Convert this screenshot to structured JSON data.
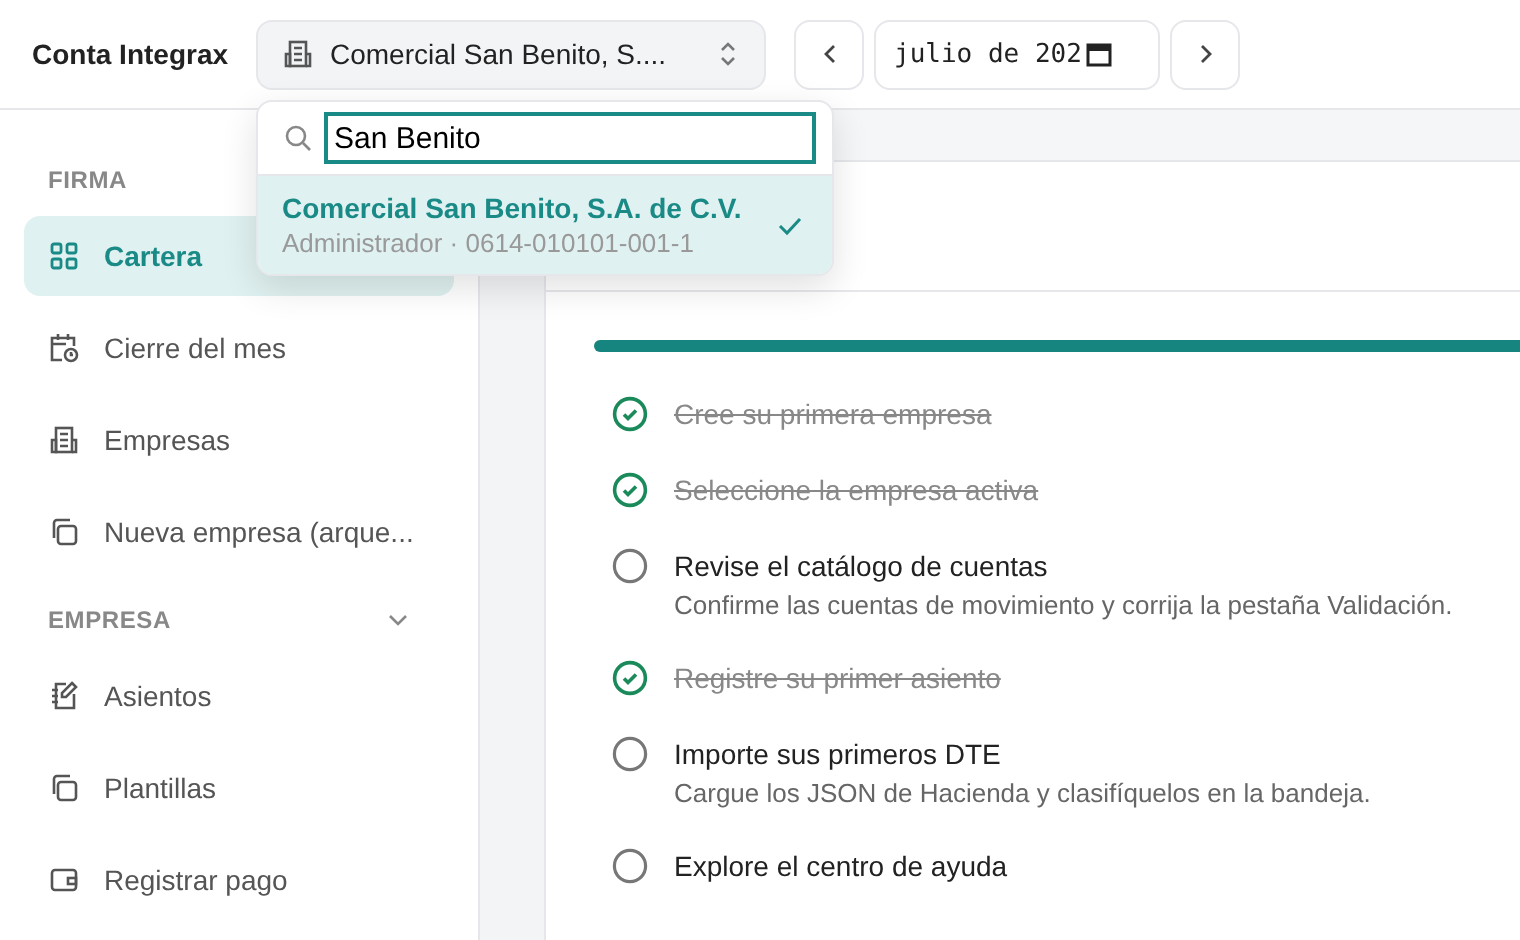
{
  "app_title": "Conta Integrax",
  "company_selector": {
    "value": "Comercial San Benito, S...."
  },
  "period": {
    "value": "julio de 202"
  },
  "company_dropdown": {
    "search": {
      "value": "San Benito"
    },
    "options": [
      {
        "name": "Comercial San Benito, S.A. de C.V.",
        "detail": "Administrador · 0614-010101-001-1",
        "selected": true
      }
    ]
  },
  "sidebar": {
    "sections": [
      {
        "title": "FIRMA",
        "collapsible": false,
        "items": [
          {
            "label": "Cartera",
            "kind": "grid",
            "selected": true
          },
          {
            "label": "Cierre del mes",
            "kind": "calendar-clock",
            "selected": false
          },
          {
            "label": "Empresas",
            "kind": "building",
            "selected": false
          },
          {
            "label": "Nueva empresa (arque...",
            "kind": "copy",
            "selected": false
          }
        ]
      },
      {
        "title": "EMPRESA",
        "collapsible": true,
        "items": [
          {
            "label": "Asientos",
            "kind": "notebook",
            "selected": false
          },
          {
            "label": "Plantillas",
            "kind": "copy",
            "selected": false
          },
          {
            "label": "Registrar pago",
            "kind": "wallet",
            "selected": false
          }
        ]
      }
    ]
  },
  "progress": {
    "level": 1
  },
  "checklist": [
    {
      "title": "Cree su primera empresa",
      "done": true
    },
    {
      "title": "Seleccione la empresa activa",
      "done": true
    },
    {
      "title": "Revise el catálogo de cuentas",
      "description": "Confirme las cuentas de movimiento y corrija la pestaña Validación.",
      "done": false
    },
    {
      "title": "Registre su primer asiento",
      "done": true
    },
    {
      "title": "Importe sus primeros DTE",
      "description": "Cargue los JSON de Hacienda y clasifíquelos en la bandeja.",
      "done": false
    },
    {
      "title": "Explore el centro de ayuda",
      "done": false
    }
  ]
}
